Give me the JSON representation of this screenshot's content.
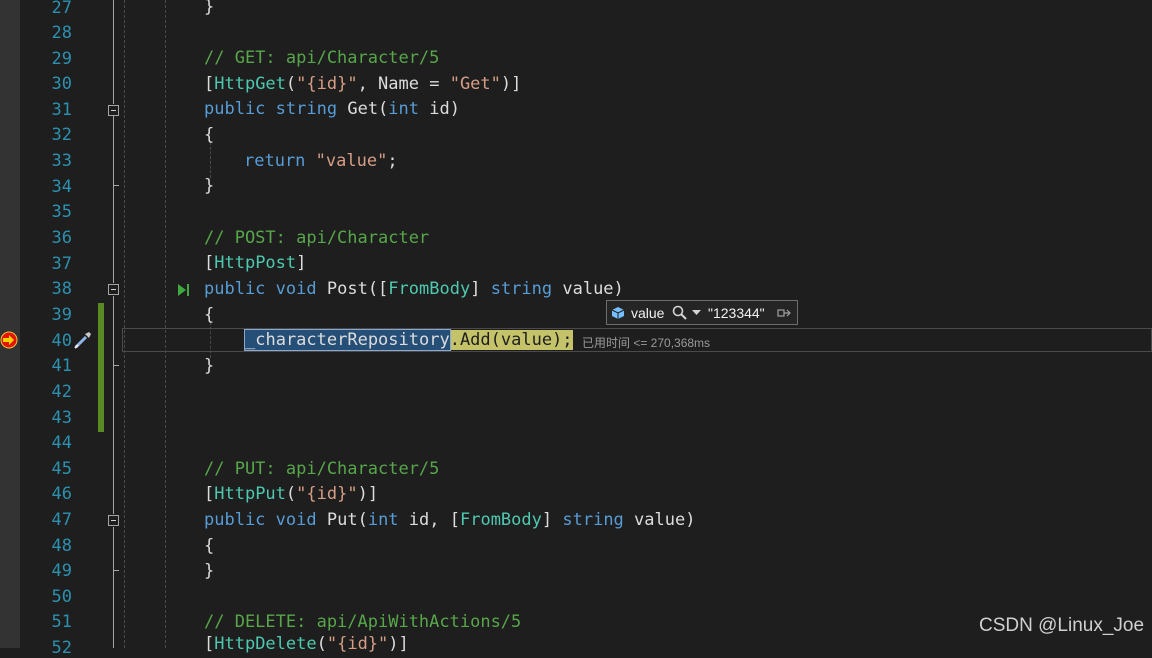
{
  "gutter": {
    "line_numbers": [
      "27",
      "28",
      "29",
      "30",
      "31",
      "32",
      "33",
      "34",
      "35",
      "36",
      "37",
      "38",
      "39",
      "40",
      "41",
      "42",
      "43",
      "44",
      "45",
      "46",
      "47",
      "48",
      "49",
      "50",
      "51",
      "52"
    ]
  },
  "code": {
    "l27": {
      "brace": "}"
    },
    "l29": {
      "comment": "// GET: api/Character/5"
    },
    "l30": {
      "lbr": "[",
      "attr": "HttpGet",
      "paren": "(",
      "str": "\"{id}\"",
      "rest": ", Name = ",
      "str2": "\"Get\"",
      "close": ")]"
    },
    "l31": {
      "kw1": "public",
      "kw2": "string",
      "name": "Get(",
      "kw3": "int",
      "rest": "id)"
    },
    "l32": {
      "brace": "{"
    },
    "l33": {
      "kw": "return",
      "str": "\"value\"",
      "semi": ";"
    },
    "l34": {
      "brace": "}"
    },
    "l36": {
      "comment": "// POST: api/Character"
    },
    "l37": {
      "lbr": "[",
      "attr": "HttpPost",
      "rbr": "]"
    },
    "l38": {
      "kw1": "public",
      "kw2": "void",
      "name": "Post([",
      "attr": "FromBody",
      "rbr": "]",
      "kw3": "string",
      "rest": "value)"
    },
    "l39": {
      "brace": "{"
    },
    "l40": {
      "selected": "_characterRepository",
      "stmt": ".Add(value);"
    },
    "l41": {
      "brace": "}"
    },
    "l45": {
      "comment": "// PUT: api/Character/5"
    },
    "l46": {
      "lbr": "[",
      "attr": "HttpPut",
      "paren": "(",
      "str": "\"{id}\"",
      "close": ")]"
    },
    "l47": {
      "kw1": "public",
      "kw2": "void",
      "name": "Put(",
      "kw3": "int",
      "mid": "id, [",
      "attr": "FromBody",
      "rbr": "]",
      "kw4": "string",
      "rest": "value)"
    },
    "l48": {
      "brace": "{"
    },
    "l49": {
      "brace": "}"
    },
    "l51": {
      "comment": "// DELETE: api/ApiWithActions/5"
    },
    "l52": {
      "lbr": "[",
      "attr": "HttpDelete",
      "paren": "(",
      "str": "\"{id}\"",
      "close": ")]"
    }
  },
  "datatip": {
    "variable": "value",
    "value": "\"123344\""
  },
  "perf_tip": {
    "text": "已用时间 <= 270,368ms"
  },
  "watermark": {
    "text": "CSDN @Linux_Joe"
  },
  "colors": {
    "background": "#1e1e1e",
    "keyword": "#569cd6",
    "string": "#d69d85",
    "comment": "#57a64a",
    "type": "#4ec9b0",
    "line_number": "#2b91af",
    "selection": "#264f78",
    "next_statement": "#c5c36a"
  }
}
